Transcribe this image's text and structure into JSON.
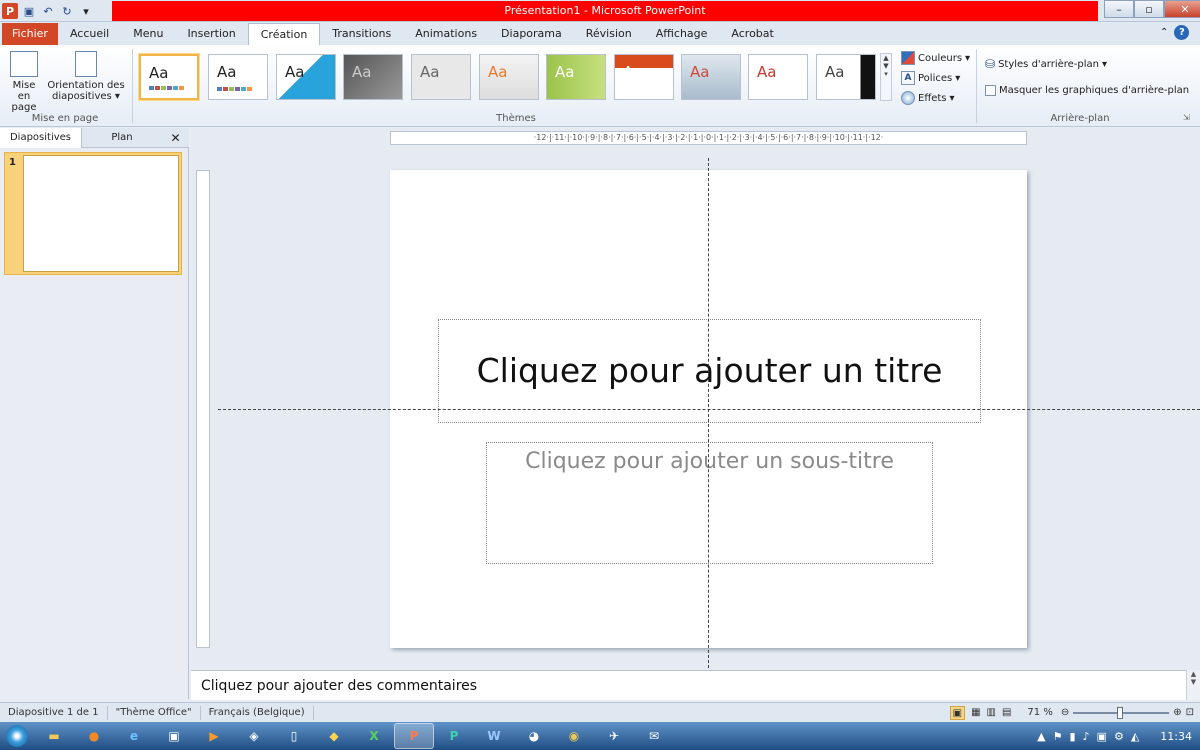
{
  "window": {
    "title": "Présentation1 - Microsoft PowerPoint"
  },
  "tabs": [
    {
      "label": "Fichier"
    },
    {
      "label": "Accueil"
    },
    {
      "label": "Menu"
    },
    {
      "label": "Insertion"
    },
    {
      "label": "Création"
    },
    {
      "label": "Transitions"
    },
    {
      "label": "Animations"
    },
    {
      "label": "Diaporama"
    },
    {
      "label": "Révision"
    },
    {
      "label": "Affichage"
    },
    {
      "label": "Acrobat"
    }
  ],
  "ribbon": {
    "page_setup": {
      "btn1": "Mise en page",
      "btn2": "Orientation des diapositives",
      "group": "Mise en page"
    },
    "themes": {
      "group": "Thèmes",
      "sample": "Aa"
    },
    "variants": {
      "colors": "Couleurs",
      "fonts": "Polices",
      "effects": "Effets"
    },
    "background": {
      "styles": "Styles d'arrière-plan",
      "hide": "Masquer les graphiques d'arrière-plan",
      "group": "Arrière-plan"
    }
  },
  "leftpane": {
    "tab1": "Diapositives",
    "tab2": "Plan",
    "slide_number": "1"
  },
  "ruler": {
    "h": "·12·|·11·|·10·|·9·|·8·|·7·|·6·|·5·|·4·|·3·|·2·|·1·|·0·|·1·|·2·|·3·|·4·|·5·|·6·|·7·|·8·|·9·|·10·|·11·|·12·"
  },
  "slide": {
    "title": "Cliquez pour ajouter un titre",
    "subtitle": "Cliquez pour ajouter un sous-titre"
  },
  "notes": {
    "placeholder": "Cliquez pour ajouter des commentaires"
  },
  "status": {
    "slide": "Diapositive 1 de 1",
    "theme": "\"Thème Office\"",
    "lang": "Français (Belgique)",
    "zoom": "71 %"
  },
  "taskbar": {
    "clock": "11:34"
  }
}
